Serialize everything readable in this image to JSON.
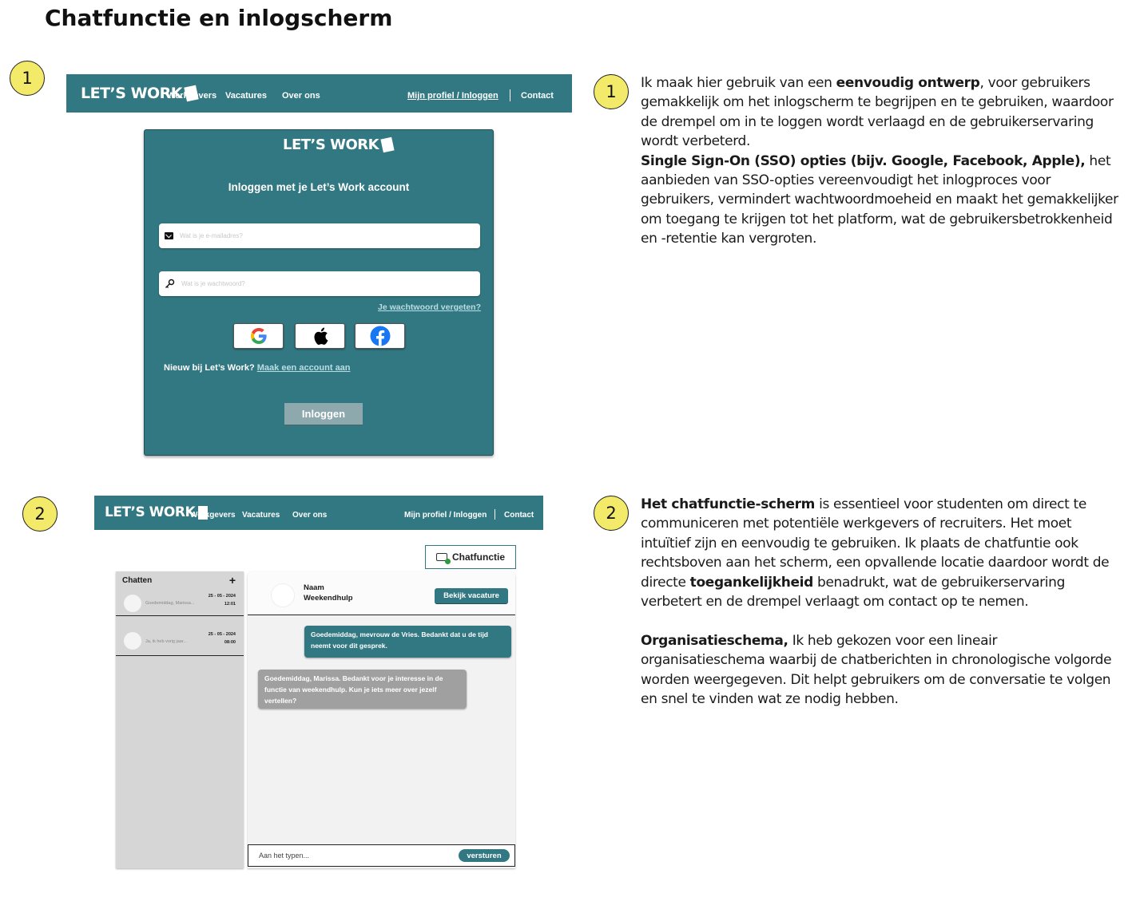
{
  "page": {
    "title": "Chatfunctie en inlogscherm"
  },
  "badges": [
    "1",
    "2"
  ],
  "brand": {
    "logo_text": "LET’S WORK",
    "primary_color": "#327882",
    "badge_color": "#f4ea6a"
  },
  "nav": {
    "werkgevers": "Werkgevers",
    "vacatures": "Vacatures",
    "over_ons": "Over ons",
    "profiel": "Mijn profiel / Inloggen",
    "contact": "Contact"
  },
  "login": {
    "heading": "Inloggen met je Let’s Work account",
    "email_placeholder": "Wat is je e-mailadres?",
    "password_placeholder": "Wat is je wachtwoord?",
    "forgot": "Je wachtwoord vergeten?",
    "sso": [
      "google-icon",
      "apple-icon",
      "facebook-icon"
    ],
    "new_user_text": "Nieuw bij Let’s Work?",
    "create_account": "Maak een account aan",
    "submit": "Inloggen"
  },
  "chat": {
    "toggle_label": "Chatfunctie",
    "list_title": "Chatten",
    "add": "+",
    "conversations": [
      {
        "preview": "Goedemiddag, Marissa...",
        "date": "25 - 05 - 2024",
        "time": "12:01"
      },
      {
        "preview": "Ja, ik heb vorig jaar...",
        "date": "25 - 05 - 2024",
        "time": "08:00"
      }
    ],
    "contact_name": "Naam",
    "contact_role": "Weekendhulp",
    "view_vacancy": "Bekijk vacature",
    "messages": [
      {
        "direction": "out",
        "text": "Goedemiddag, mevrouw de Vries. Bedankt dat u de tijd neemt voor dit gesprek."
      },
      {
        "direction": "in",
        "text": "Goedemiddag, Marissa. Bedankt voor je interesse in de functie van weekendhulp. Kun je iets meer over jezelf vertellen?"
      }
    ],
    "input_placeholder": "Aan het typen...",
    "send": "versturen"
  },
  "descriptions": {
    "d1_p1_a": "Ik maak hier gebruik van een ",
    "d1_p1_b": "eenvoudig ontwerp",
    "d1_p1_c": ", voor gebruikers gemakkelijk om het inlogscherm te begrijpen en te gebruiken, waardoor de drempel om in te loggen wordt verlaagd en de gebruikerservaring wordt verbeterd.",
    "d1_p2_a": "Single Sign-On (SSO) opties (bijv. Google, Facebook, Apple),",
    "d1_p2_b": " het aanbieden van SSO-opties vereenvoudigt het inlogproces voor gebruikers, vermindert wachtwoordmoeheid en maakt het gemakkelijker om toegang te krijgen tot het platform, wat de gebruikersbetrokkenheid en -retentie kan vergroten.",
    "d2_p1_a": "Het chatfunctie-scherm",
    "d2_p1_b": " is essentieel voor studenten om direct te communiceren met potentiële werkgevers of recruiters. Het moet intuïtief zijn en eenvoudig te gebruiken. Ik plaats de chatfuntie ook rechtsboven aan het scherm, een opvallende locatie daardoor wordt de directe ",
    "d2_p1_c": "toegankelijkheid",
    "d2_p1_d": " benadrukt, wat de gebruikerservaring verbetert en de drempel verlaagt om contact op te nemen.",
    "d2_p2_a": "Organisatieschema,",
    "d2_p2_b": " Ik heb gekozen voor een lineair organisatieschema waarbij de chatberichten in chronologische volgorde worden weergegeven. Dit helpt gebruikers om de conversatie te volgen en snel te vinden wat ze nodig hebben."
  }
}
